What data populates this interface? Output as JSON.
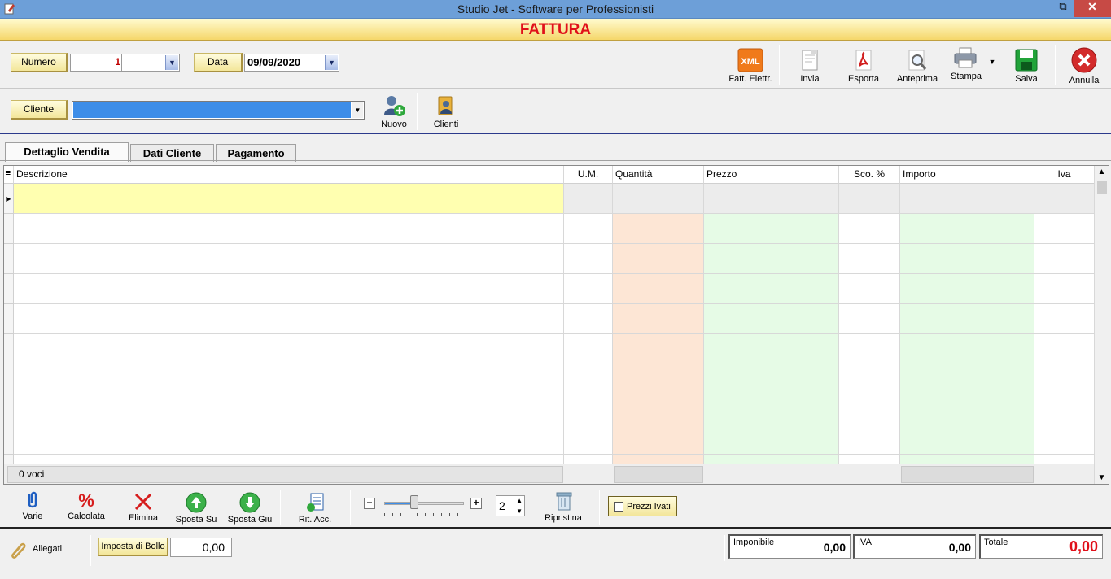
{
  "window": {
    "title": "Studio Jet - Software per Professionisti",
    "minimize": "‒",
    "maximize": "⧉",
    "close": "✕"
  },
  "banner": {
    "title": "FATTURA"
  },
  "header": {
    "numero_label": "Numero",
    "numero_value": "1",
    "data_label": "Data",
    "data_value": "09/09/2020",
    "cliente_label": "Cliente"
  },
  "toolbar": {
    "fatt_elettr": "Fatt. Elettr.",
    "xml_badge": "XML",
    "invia": "Invia",
    "esporta": "Esporta",
    "anteprima": "Anteprima",
    "stampa": "Stampa",
    "salva": "Salva",
    "annulla": "Annulla",
    "nuovo": "Nuovo",
    "clienti": "Clienti"
  },
  "tabs": [
    {
      "label": "Dettaglio Vendita",
      "active": true
    },
    {
      "label": "Dati Cliente",
      "active": false
    },
    {
      "label": "Pagamento",
      "active": false
    }
  ],
  "grid": {
    "columns": [
      "Descrizione",
      "U.M.",
      "Quantità",
      "Prezzo",
      "Sco. %",
      "Importo",
      "Iva"
    ],
    "rows": [],
    "footer_count": "0 voci"
  },
  "bottom_toolbar": {
    "varie": "Varie",
    "calcolata": "Calcolata",
    "elimina": "Elimina",
    "sposta_su": "Sposta Su",
    "sposta_giu": "Sposta Giu",
    "rit_acc": "Rit. Acc.",
    "zoom_minus": "−",
    "zoom_plus": "+",
    "zoom_level": 0.38,
    "spin_value": "2",
    "ripristina": "Ripristina",
    "prezzi_ivati": "Prezzi Ivati"
  },
  "status": {
    "allegati": "Allegati",
    "imposta_bollo_label": "Imposta di Bollo",
    "imposta_bollo_value": "0,00",
    "imponibile_label": "Imponibile",
    "imponibile_value": "0,00",
    "iva_label": "IVA",
    "iva_value": "0,00",
    "totale_label": "Totale",
    "totale_value": "0,00"
  },
  "colors": {
    "title_bar": "#6d9fd8",
    "banner_text": "#e0101a",
    "quantita_col": "#fde6d5",
    "prezzo_col": "#e6fbe6",
    "selected_row": "#ffffb0",
    "totale_text": "#e0101a"
  }
}
